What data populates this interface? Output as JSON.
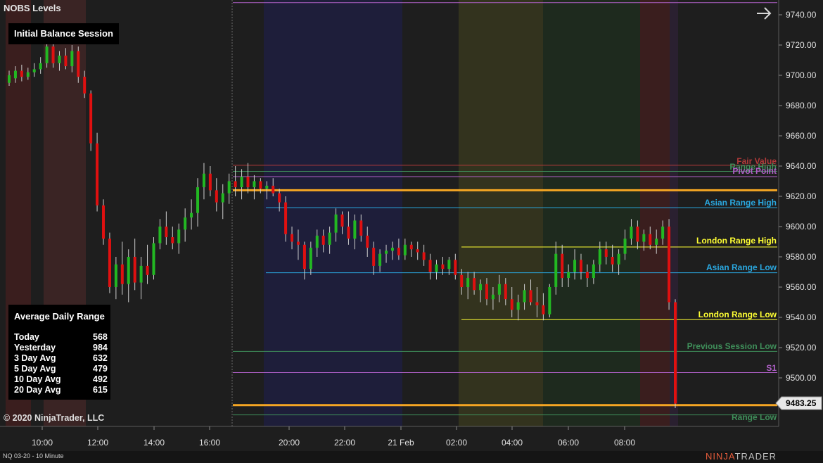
{
  "header": {
    "title": "NOBS Levels"
  },
  "initial_balance": {
    "label": "Initial Balance Session"
  },
  "adr_panel": {
    "title": "Average Daily Range",
    "rows": [
      {
        "label": "Today",
        "value": "568"
      },
      {
        "label": "Yesterday",
        "value": "984"
      },
      {
        "label": "3 Day Avg",
        "value": "632"
      },
      {
        "label": "5 Day Avg",
        "value": "479"
      },
      {
        "label": "10 Day Avg",
        "value": "492"
      },
      {
        "label": "20 Day Avg",
        "value": "615"
      }
    ]
  },
  "copyright": "© 2020 NinjaTrader, LLC",
  "instrument": "NQ 03-20 - 10 Minute",
  "brand": {
    "a": "NINJA",
    "b": "TRADER"
  },
  "chart_data": {
    "type": "candlestick",
    "ylim": [
      9475,
      9750
    ],
    "y_ticks": [
      "9740.00",
      "9720.00",
      "9700.00",
      "9680.00",
      "9660.00",
      "9640.00",
      "9620.00",
      "9600.00",
      "9580.00",
      "9560.00",
      "9540.00",
      "9520.00",
      "9500.00"
    ],
    "x_ticks": [
      "10:00",
      "12:00",
      "14:00",
      "16:00",
      "20:00",
      "22:00",
      "21 Feb",
      "02:00",
      "04:00",
      "06:00",
      "08:00"
    ],
    "last_price": "9483.25",
    "colors": {
      "up": "#22b822",
      "down": "#e01010",
      "orange": "#f5a623"
    },
    "levels": [
      {
        "label": "Fair Value",
        "value": 9640.5,
        "color": "#b23a3a"
      },
      {
        "label": "Range High",
        "value": 9636.5,
        "color": "#3f8f5a"
      },
      {
        "label": "Pivot Point",
        "value": 9633.0,
        "color": "#b060c8"
      },
      {
        "label": "Asian Range High",
        "value": 9612.5,
        "color": "#2aa8e0"
      },
      {
        "label": "London Range High",
        "value": 9586.5,
        "color": "#ffff33"
      },
      {
        "label": "Asian Range Low",
        "value": 9569.5,
        "color": "#2aa8e0"
      },
      {
        "label": "London Range Low",
        "value": 9538.5,
        "color": "#ffff33"
      },
      {
        "label": "Previous Session Low",
        "value": 9517.5,
        "color": "#3f8f5a"
      },
      {
        "label": "S1",
        "value": 9503.5,
        "color": "#b060c8"
      },
      {
        "label": "Range Low",
        "value": 9475.5,
        "color": "#3f8f5a"
      }
    ],
    "unlabeled_levels": [
      {
        "value": 9748.0,
        "color": "#b060c8"
      },
      {
        "value": 9624.0,
        "color": "#f5a623"
      },
      {
        "value": 9482.0,
        "color": "#f5a623"
      }
    ],
    "candles": [
      [
        9695,
        9703,
        9693,
        9700
      ],
      [
        9698,
        9706,
        9695,
        9703
      ],
      [
        9703,
        9707,
        9696,
        9699
      ],
      [
        9699,
        9705,
        9697,
        9702
      ],
      [
        9702,
        9708,
        9699,
        9704
      ],
      [
        9704,
        9712,
        9701,
        9708
      ],
      [
        9708,
        9724,
        9705,
        9719
      ],
      [
        9719,
        9722,
        9705,
        9708
      ],
      [
        9708,
        9716,
        9703,
        9713
      ],
      [
        9713,
        9718,
        9704,
        9706
      ],
      [
        9706,
        9720,
        9702,
        9716
      ],
      [
        9716,
        9719,
        9695,
        9699
      ],
      [
        9699,
        9703,
        9685,
        9688
      ],
      [
        9688,
        9690,
        9650,
        9655
      ],
      [
        9655,
        9662,
        9610,
        9614
      ],
      [
        9614,
        9618,
        9588,
        9592
      ],
      [
        9592,
        9596,
        9556,
        9560
      ],
      [
        9560,
        9580,
        9552,
        9575
      ],
      [
        9575,
        9590,
        9555,
        9562
      ],
      [
        9562,
        9585,
        9550,
        9580
      ],
      [
        9580,
        9592,
        9558,
        9563
      ],
      [
        9563,
        9580,
        9552,
        9574
      ],
      [
        9574,
        9588,
        9562,
        9568
      ],
      [
        9568,
        9593,
        9565,
        9589
      ],
      [
        9589,
        9605,
        9585,
        9600
      ],
      [
        9600,
        9610,
        9588,
        9593
      ],
      [
        9593,
        9600,
        9585,
        9589
      ],
      [
        9589,
        9602,
        9582,
        9598
      ],
      [
        9598,
        9612,
        9590,
        9606
      ],
      [
        9606,
        9618,
        9598,
        9609
      ],
      [
        9609,
        9632,
        9600,
        9626
      ],
      [
        9626,
        9642,
        9618,
        9635
      ],
      [
        9635,
        9640,
        9620,
        9624
      ],
      [
        9624,
        9632,
        9610,
        9616
      ],
      [
        9616,
        9628,
        9605,
        9622
      ],
      [
        9622,
        9635,
        9615,
        9630
      ],
      [
        9630,
        9640,
        9620,
        9626
      ],
      [
        9626,
        9638,
        9618,
        9633
      ],
      [
        9633,
        9642,
        9622,
        9626
      ],
      [
        9626,
        9634,
        9618,
        9630
      ],
      [
        9630,
        9632,
        9622,
        9625
      ],
      [
        9625,
        9630,
        9618,
        9627
      ],
      [
        9627,
        9632,
        9620,
        9622
      ],
      [
        9622,
        9625,
        9610,
        9616
      ],
      [
        9616,
        9620,
        9590,
        9595
      ],
      [
        9595,
        9600,
        9585,
        9590
      ],
      [
        9590,
        9598,
        9578,
        9588
      ],
      [
        9588,
        9590,
        9565,
        9572
      ],
      [
        9572,
        9590,
        9568,
        9586
      ],
      [
        9586,
        9598,
        9580,
        9594
      ],
      [
        9594,
        9598,
        9583,
        9588
      ],
      [
        9588,
        9600,
        9582,
        9596
      ],
      [
        9596,
        9612,
        9590,
        9608
      ],
      [
        9608,
        9610,
        9595,
        9600
      ],
      [
        9600,
        9610,
        9588,
        9592
      ],
      [
        9592,
        9608,
        9585,
        9604
      ],
      [
        9604,
        9608,
        9590,
        9594
      ],
      [
        9594,
        9600,
        9580,
        9586
      ],
      [
        9586,
        9590,
        9568,
        9574
      ],
      [
        9574,
        9585,
        9570,
        9582
      ],
      [
        9582,
        9588,
        9576,
        9584
      ],
      [
        9584,
        9590,
        9578,
        9586
      ],
      [
        9586,
        9592,
        9578,
        9581
      ],
      [
        9581,
        9592,
        9578,
        9588
      ],
      [
        9588,
        9590,
        9580,
        9585
      ],
      [
        9585,
        9590,
        9578,
        9583
      ],
      [
        9583,
        9588,
        9574,
        9578
      ],
      [
        9578,
        9582,
        9565,
        9570
      ],
      [
        9570,
        9578,
        9565,
        9575
      ],
      [
        9575,
        9580,
        9568,
        9572
      ],
      [
        9572,
        9580,
        9568,
        9578
      ],
      [
        9578,
        9582,
        9565,
        9568
      ],
      [
        9568,
        9572,
        9555,
        9560
      ],
      [
        9560,
        9570,
        9552,
        9566
      ],
      [
        9566,
        9570,
        9555,
        9558
      ],
      [
        9558,
        9565,
        9550,
        9562
      ],
      [
        9562,
        9566,
        9548,
        9552
      ],
      [
        9552,
        9560,
        9545,
        9555
      ],
      [
        9555,
        9568,
        9550,
        9562
      ],
      [
        9562,
        9566,
        9548,
        9552
      ],
      [
        9552,
        9560,
        9540,
        9545
      ],
      [
        9545,
        9555,
        9538,
        9550
      ],
      [
        9550,
        9562,
        9545,
        9558
      ],
      [
        9558,
        9565,
        9548,
        9550
      ],
      [
        9550,
        9560,
        9540,
        9548
      ],
      [
        9548,
        9556,
        9538,
        9542
      ],
      [
        9542,
        9562,
        9540,
        9560
      ],
      [
        9560,
        9590,
        9555,
        9582
      ],
      [
        9582,
        9588,
        9560,
        9566
      ],
      [
        9566,
        9575,
        9560,
        9570
      ],
      [
        9570,
        9585,
        9565,
        9578
      ],
      [
        9578,
        9582,
        9565,
        9570
      ],
      [
        9570,
        9575,
        9560,
        9566
      ],
      [
        9566,
        9578,
        9562,
        9575
      ],
      [
        9575,
        9590,
        9570,
        9585
      ],
      [
        9585,
        9590,
        9575,
        9580
      ],
      [
        9580,
        9588,
        9570,
        9575
      ],
      [
        9575,
        9585,
        9568,
        9582
      ],
      [
        9582,
        9598,
        9578,
        9592
      ],
      [
        9592,
        9605,
        9588,
        9600
      ],
      [
        9600,
        9604,
        9585,
        9590
      ],
      [
        9590,
        9598,
        9584,
        9595
      ],
      [
        9595,
        9600,
        9585,
        9588
      ],
      [
        9588,
        9598,
        9582,
        9592
      ],
      [
        9592,
        9604,
        9588,
        9600
      ],
      [
        9600,
        9605,
        9545,
        9550
      ],
      [
        9550,
        9552,
        9480,
        9483
      ]
    ]
  }
}
